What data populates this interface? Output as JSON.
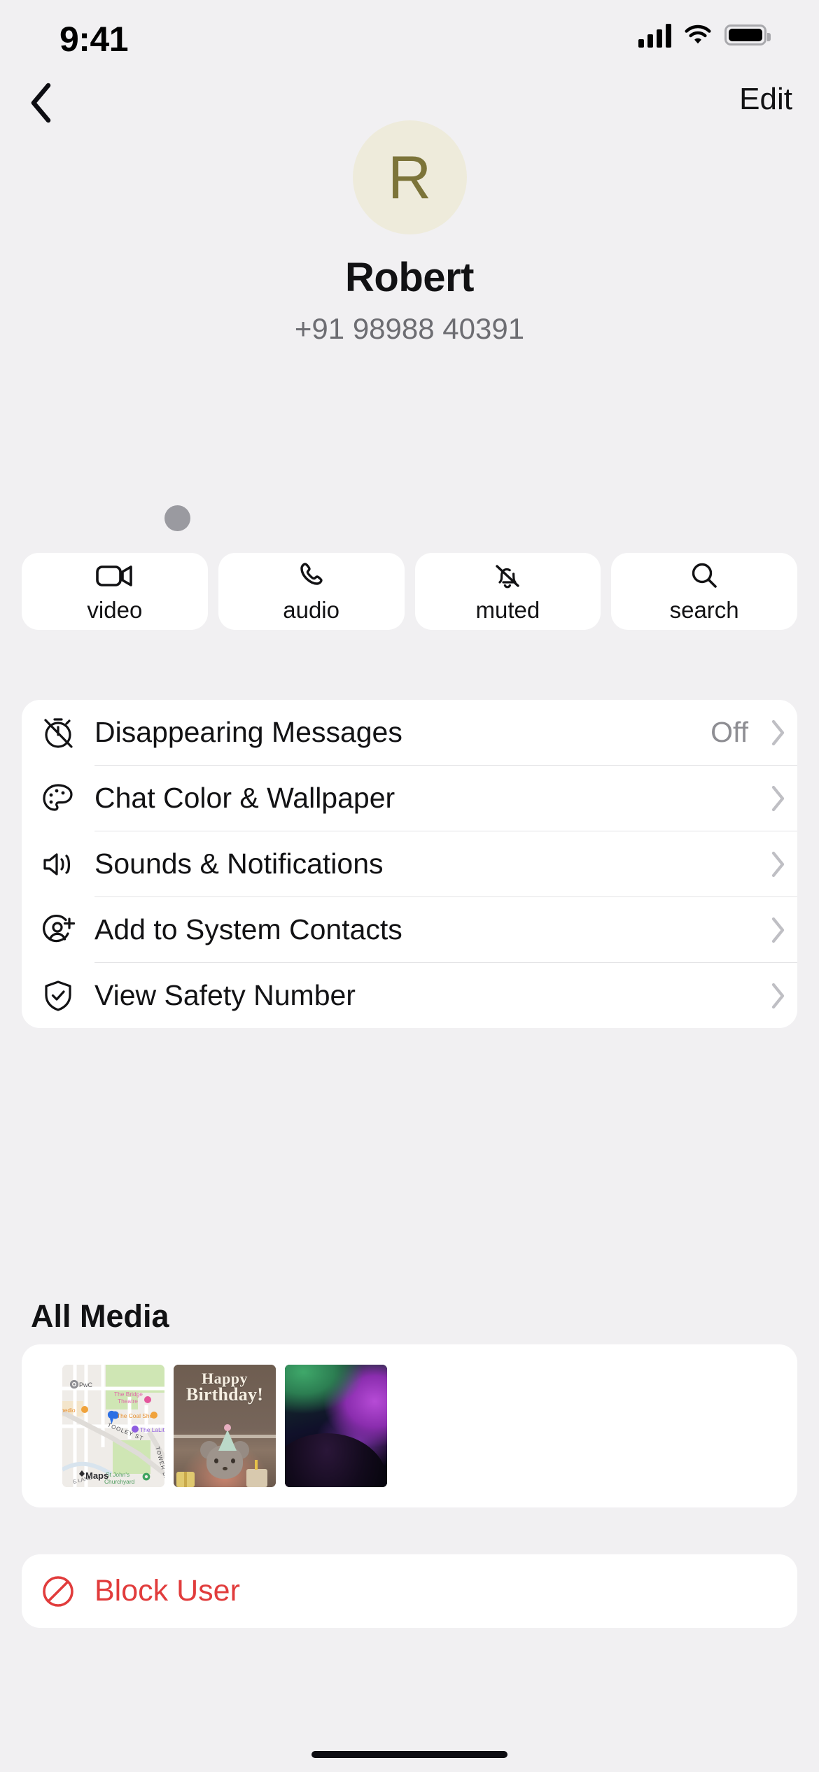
{
  "status_bar": {
    "time": "9:41",
    "cellular_icon": "signal-bars-icon",
    "wifi_icon": "wifi-icon",
    "battery_icon": "battery-icon"
  },
  "nav": {
    "back_icon": "chevron-left-icon",
    "edit_label": "Edit"
  },
  "profile": {
    "avatar_initial": "R",
    "avatar_bg": "#EEEBDB",
    "avatar_fg": "#7C7439",
    "name": "Robert",
    "phone": "+91 98988 40391"
  },
  "actions": [
    {
      "label": "video",
      "icon": "video-camera-icon"
    },
    {
      "label": "audio",
      "icon": "phone-icon"
    },
    {
      "label": "muted",
      "icon": "bell-slash-icon"
    },
    {
      "label": "search",
      "icon": "magnifier-icon"
    }
  ],
  "settings": [
    {
      "label": "Disappearing Messages",
      "value": "Off",
      "icon": "timer-off-icon",
      "chevron": "chevron-right-icon"
    },
    {
      "label": "Chat Color & Wallpaper",
      "value": "",
      "icon": "palette-icon",
      "chevron": "chevron-right-icon"
    },
    {
      "label": "Sounds & Notifications",
      "value": "",
      "icon": "speaker-wave-icon",
      "chevron": "chevron-right-icon"
    },
    {
      "label": "Add to System Contacts",
      "value": "",
      "icon": "person-plus-icon",
      "chevron": "chevron-right-icon"
    },
    {
      "label": "View Safety Number",
      "value": "",
      "icon": "shield-check-icon",
      "chevron": "chevron-right-icon"
    }
  ],
  "media": {
    "title": "All Media",
    "items": [
      {
        "type": "map-thumbnail",
        "name": "map-screenshot",
        "labels": {
          "pwc": "PwC",
          "bridge_theatre": "The Bridge Theatre",
          "coal_shed": "The Coal Shed",
          "lalit": "The LaLit",
          "tooley_st": "TOOLEY ST",
          "tower_bridge": "TOWER BRIDGE",
          "churchyard": "St John's Churchyard",
          "medio": "medio",
          "watermark": "Maps"
        }
      },
      {
        "type": "photo",
        "name": "birthday-photo",
        "text_line_1": "Happy",
        "text_line_2": "Birthday!"
      },
      {
        "type": "photo",
        "name": "gradient-wallpaper"
      }
    ]
  },
  "block": {
    "label": "Block User",
    "icon": "block-circle-slash-icon",
    "color": "#E13C3C"
  },
  "cursor": {
    "name": "touch-indicator"
  },
  "colors": {
    "page_bg": "#F1F0F2",
    "card_bg": "#FFFFFF",
    "primary_text": "#121214",
    "secondary_text": "#8E8E93",
    "divider": "#E2E2E4",
    "danger": "#E13C3C"
  }
}
